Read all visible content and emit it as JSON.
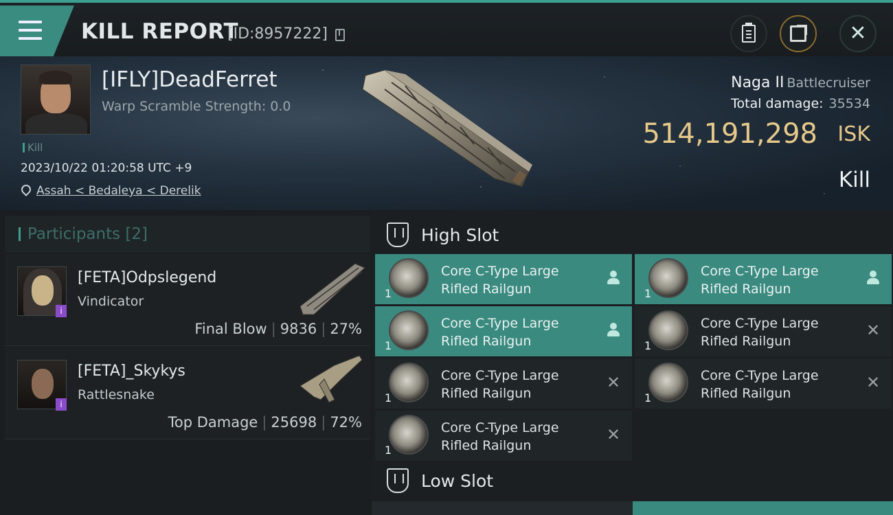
{
  "header": {
    "title": "KILL REPORT",
    "report_id": "[ID:8957222]"
  },
  "victim": {
    "name": "[IFLY]DeadFerret",
    "warp_scramble": "Warp Scramble Strength: 0.0",
    "tag": "Kill",
    "datetime": "2023/10/22 01:20:58 UTC +9",
    "location": "Assah < Bedaleya < Derelik",
    "ship_name": "Naga II",
    "ship_class": "Battlecruiser",
    "total_damage_label": "Total damage:",
    "total_damage": "35534",
    "isk_value": "514,191,298",
    "isk_unit": "ISK",
    "result": "Kill"
  },
  "participants": {
    "title": "Participants [2]",
    "rows": [
      {
        "name": "[FETA]Odpslegend",
        "ship": "Vindicator",
        "label": "Final Blow",
        "damage": "9836",
        "percent": "27%",
        "badge": "i"
      },
      {
        "name": "[FETA]_Skykys",
        "ship": "Rattlesnake",
        "label": "Top Damage",
        "damage": "25698",
        "percent": "72%",
        "badge": "i"
      }
    ]
  },
  "fitting": {
    "high_slot_title": "High Slot",
    "low_slot_title": "Low Slot",
    "modules": [
      {
        "line1": "Core C-Type Large",
        "line2": "Rifled Railgun",
        "qty": "1",
        "state": "person"
      },
      {
        "line1": "Core C-Type Large",
        "line2": "Rifled Railgun",
        "qty": "1",
        "state": "person"
      },
      {
        "line1": "Core C-Type Large",
        "line2": "Rifled Railgun",
        "qty": "1",
        "state": "person"
      },
      {
        "line1": "Core C-Type Large",
        "line2": "Rifled Railgun",
        "qty": "1",
        "state": "x"
      },
      {
        "line1": "Core C-Type Large",
        "line2": "Rifled Railgun",
        "qty": "1",
        "state": "x"
      },
      {
        "line1": "Core C-Type Large",
        "line2": "Rifled Railgun",
        "qty": "1",
        "state": "x"
      },
      {
        "line1": "Core C-Type Large",
        "line2": "Rifled Railgun",
        "qty": "1",
        "state": "x"
      }
    ]
  },
  "icons": {
    "menu": "hamburger-menu-icon",
    "copy": "copy-icon",
    "clipboard": "clipboard-icon",
    "share": "share-icon",
    "close": "close-icon",
    "location": "location-pin-icon",
    "slot": "slot-shield-icon",
    "pilot": "pilot-icon",
    "empty": "x-icon"
  },
  "colors": {
    "accent": "#3d9f90",
    "highlight": "#3b8a80",
    "isk": "#e6c98a"
  }
}
